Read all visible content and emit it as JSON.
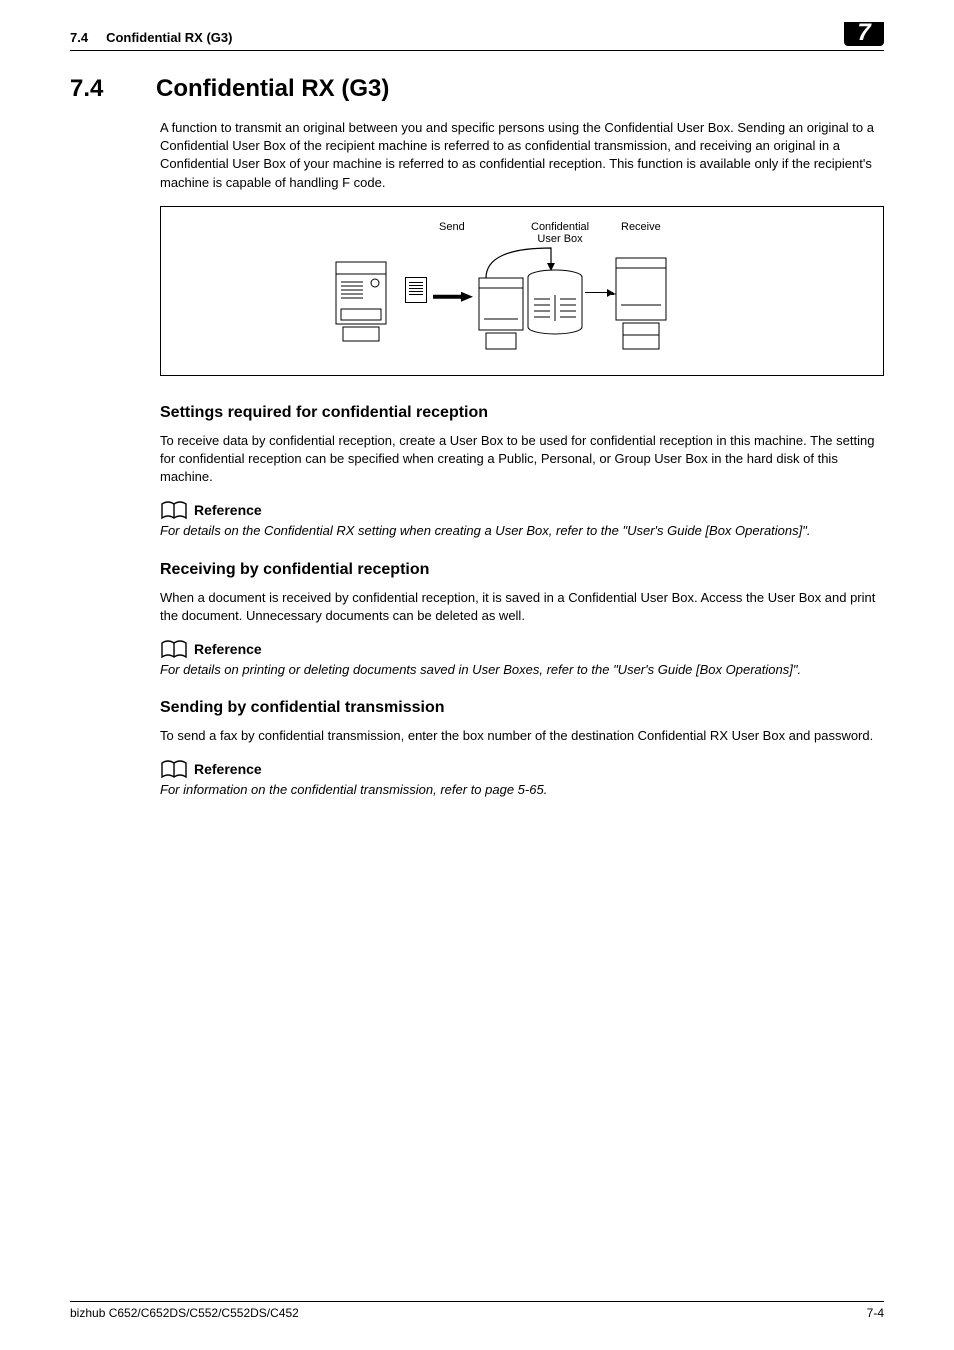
{
  "header": {
    "section_num": "7.4",
    "section_title": "Confidential RX (G3)",
    "chapter": "7"
  },
  "main": {
    "num": "7.4",
    "title": "Confidential RX (G3)",
    "intro": "A function to transmit an original between you and specific persons using the Confidential User Box. Sending an original to a Confidential User Box of the recipient machine is referred to as confidential transmission, and receiving an original in a Confidential User Box of your machine is referred to as confidential reception. This function is available only if the recipient's machine is capable of handling F code.",
    "figure": {
      "send_label": "Send",
      "box_label": "Confidential\nUser Box",
      "receive_label": "Receive"
    },
    "s1": {
      "heading": "Settings required for confidential reception",
      "body": "To receive data by confidential reception, create a User Box to be used for confidential reception in this machine. The setting for confidential reception can be specified when creating a Public, Personal, or Group User Box in the hard disk of this machine.",
      "ref_label": "Reference",
      "ref_text": "For details on the Confidential RX setting when creating a User Box, refer to the \"User's Guide [Box Operations]\"."
    },
    "s2": {
      "heading": "Receiving by confidential reception",
      "body": "When a document is received by confidential reception, it is saved in a Confidential User Box. Access the User Box and print the document. Unnecessary documents can be deleted as well.",
      "ref_label": "Reference",
      "ref_text": "For details on printing or deleting documents saved in User Boxes, refer to the \"User's Guide [Box Operations]\"."
    },
    "s3": {
      "heading": "Sending by confidential transmission",
      "body": "To send a fax by confidential transmission, enter the box number of the destination Confidential RX User Box and password.",
      "ref_label": "Reference",
      "ref_text": "For information on the confidential transmission, refer to page 5-65."
    }
  },
  "footer": {
    "model": "bizhub C652/C652DS/C552/C552DS/C452",
    "page": "7-4"
  }
}
